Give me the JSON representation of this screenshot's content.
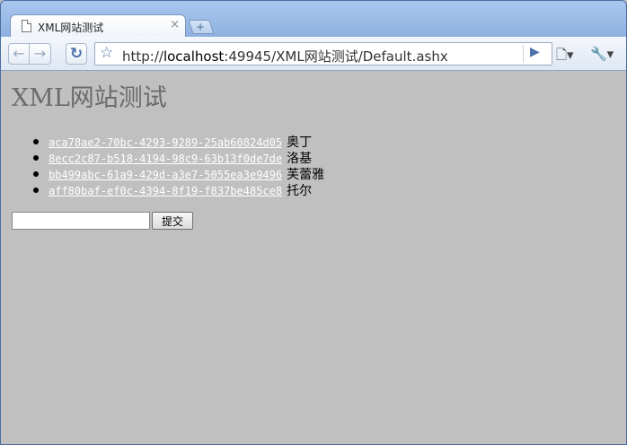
{
  "browser": {
    "tab_title": "XML网站测试",
    "tab_close": "×",
    "new_tab_icon": "+",
    "url_prefix": "http://",
    "url_host": "localhost",
    "url_rest": ":49945/XML网站测试/Default.ashx",
    "icons": {
      "back": "←",
      "forward": "→",
      "reload": "↻",
      "star": "☆",
      "go": "▶",
      "page_menu": "🗋▾",
      "wrench": "🔧▾"
    }
  },
  "page": {
    "title": "XML网站测试",
    "items": [
      {
        "id": "aca78ae2-70bc-4293-9289-25ab60824d05",
        "name": "奥丁"
      },
      {
        "id": "8ecc2c87-b518-4194-98c9-63b13f0de7de",
        "name": "洛基"
      },
      {
        "id": "bb499abc-61a9-429d-a3e7-5055ea3e9496",
        "name": "芙蕾雅"
      },
      {
        "id": "aff80baf-ef0c-4394-8f19-f837be485ce8",
        "name": "托尔"
      }
    ],
    "input_value": "",
    "submit_label": "提交"
  }
}
